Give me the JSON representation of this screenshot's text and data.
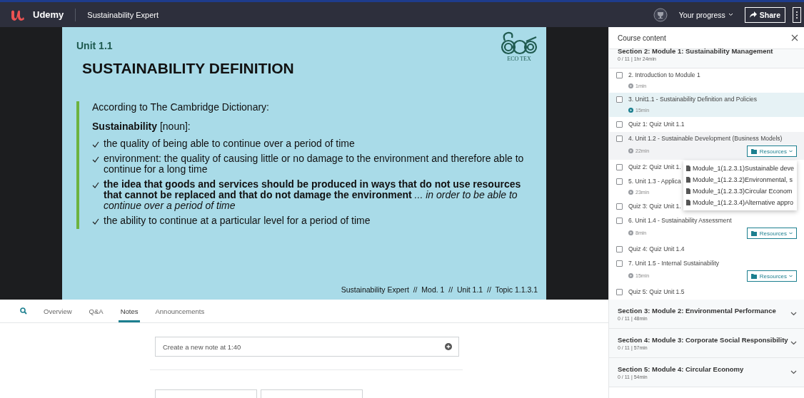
{
  "header": {
    "logo": "Udemy",
    "course_title": "Sustainability Expert",
    "progress_label": "Your progress",
    "share_label": "Share"
  },
  "slide": {
    "unit": "Unit 1.1",
    "title": "SUSTAINABILITY DEFINITION",
    "logo_caption": "ECO TEX",
    "intro": "According to The Cambridge Dictionary:",
    "term": "**Sustainability** [noun]:",
    "bullets": [
      "the quality of being able to continue over a period of time",
      "environment: the quality of causing little or no damage to the environment and therefore able to continue for a long time",
      "**the idea that goods and services should be produced in ways that do not use resources that cannot be replaced and that do not damage the environment** *... in order to be able to continue over a period of time*",
      "the ability to continue at a particular level for a period of time"
    ],
    "footer": "Sustainability Expert  //  Mod. 1  //  Unit 1.1  //  Topic 1.1.3.1"
  },
  "tabs": [
    {
      "label": "Overview",
      "selected": false
    },
    {
      "label": "Q&A",
      "selected": false
    },
    {
      "label": "Notes",
      "selected": true
    },
    {
      "label": "Announcements",
      "selected": false
    }
  ],
  "note": {
    "placeholder": "Create a new note at 1:40"
  },
  "sidebar": {
    "title": "Course content",
    "sections": [
      {
        "title": "Section 2: Module 1: Sustainability Management",
        "meta": "0 / 11 | 1hr 24min",
        "expanded": true,
        "items": [
          {
            "title": "2. Introduction to Module 1",
            "duration": "1min",
            "checked": false,
            "selected": false,
            "hovered": false
          },
          {
            "title": "3. Unit1.1 - Sustainability Definition and Policies",
            "duration": "15min",
            "checked": false,
            "selected": true,
            "hovered": false
          },
          {
            "title": "Quiz 1: Quiz Unit 1.1",
            "checked": false,
            "selected": false,
            "hovered": false
          },
          {
            "title": "4. Unit 1.2 - Sustainable Development (Business Models)",
            "duration": "22min",
            "checked": false,
            "selected": false,
            "hovered": true,
            "resources": "Resources",
            "menu": [
              "Module_1(1.2.3.1)Sustainable deve",
              "Module_1(1.2.3.2)Environmental, s",
              "Module_1(1.2.3.3)Circular Econom",
              "Module_1(1.2.3.4)Alternative appro"
            ]
          },
          {
            "title": "Quiz 2: Quiz Unit 1.",
            "checked": false,
            "selected": false,
            "hovered": false
          },
          {
            "title": "5. Unit 1.3 - Applica",
            "duration": "23min",
            "checked": false,
            "selected": false,
            "hovered": false
          },
          {
            "title": "Quiz 3: Quiz Unit 1.",
            "checked": false,
            "selected": false,
            "hovered": false
          },
          {
            "title": "6. Unit 1.4 - Sustainability Assessment",
            "duration": "8min",
            "checked": false,
            "selected": false,
            "hovered": false,
            "resources": "Resources"
          },
          {
            "title": "Quiz 4: Quiz Unit 1.4",
            "checked": false,
            "selected": false,
            "hovered": false
          },
          {
            "title": "7. Unit 1.5 - Internal Sustainability",
            "duration": "15min",
            "checked": false,
            "selected": false,
            "hovered": false,
            "resources": "Resources"
          },
          {
            "title": "Quiz 5: Quiz Unit 1.5",
            "checked": false,
            "selected": false,
            "hovered": false
          }
        ]
      },
      {
        "title": "Section 3: Module 2: Environmental Performance",
        "meta": "0 / 11 | 48min",
        "expanded": false
      },
      {
        "title": "Section 4: Module 3: Corporate Social Responsibility",
        "meta": "0 / 11 | 57min",
        "expanded": false
      },
      {
        "title": "Section 5: Module 4: Circular Economy",
        "meta": "0 / 11 | 54min",
        "expanded": false
      }
    ]
  }
}
